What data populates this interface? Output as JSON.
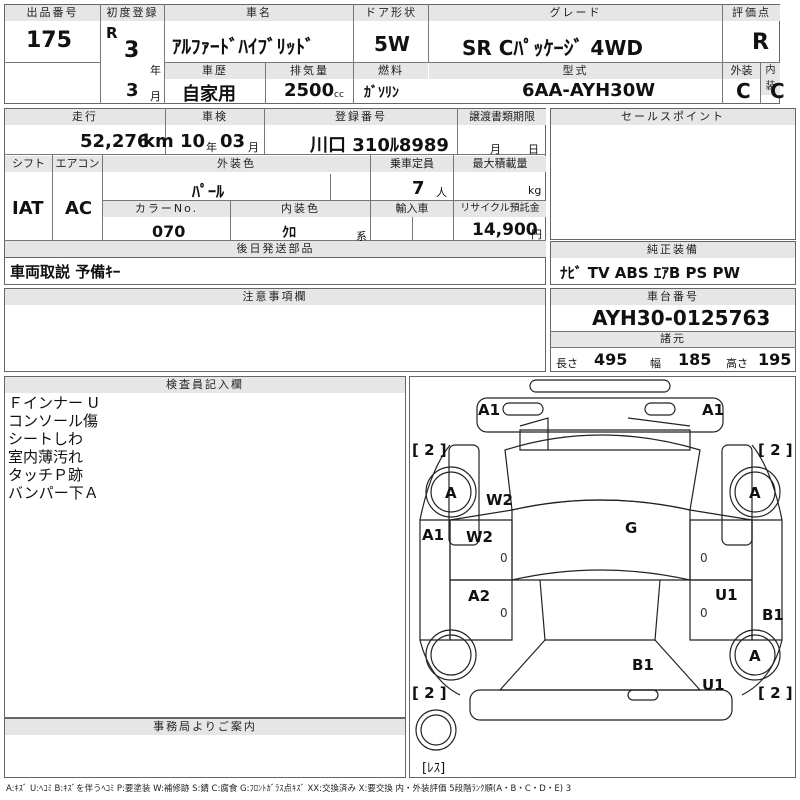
{
  "listing": {
    "lot_label": "出品番号",
    "lot_number": "175",
    "first_reg_label": "初度登録",
    "era": "R",
    "year": "3",
    "year_unit": "年",
    "month": "3",
    "month_unit": "月",
    "car_name_label": "車名",
    "car_name": "ｱﾙﾌｧｰﾄﾞﾊｲﾌﾞﾘｯﾄﾞ",
    "door_label": "ドア形状",
    "door": "5W",
    "grade_label": "グレード",
    "grade": "SR Cﾊﾟｯｹｰｼﾞ 4WD",
    "score_label": "評価点",
    "score": "R",
    "history_label": "車歴",
    "history": "自家用",
    "displacement_label": "排気量",
    "displacement": "2500",
    "displacement_unit": "cc",
    "fuel_label": "燃料",
    "fuel": "ｶﾞｿﾘﾝ",
    "model_label": "型式",
    "model": "6AA-AYH30W",
    "exterior_label": "外装",
    "exterior": "C",
    "interior_label": "内装",
    "interior": "C"
  },
  "row2": {
    "mileage_label": "走行",
    "mileage": "52,276",
    "mileage_unit": "km",
    "inspection_label": "車検",
    "insp_year": "10",
    "insp_year_unit": "年",
    "insp_month": "03",
    "insp_month_unit": "月",
    "reg_label": "登録番号",
    "reg_number": "川口 310ﾙ8989",
    "transfer_label": "譲渡書類期限",
    "transfer_month": "月",
    "transfer_day": "日",
    "shift_label": "シフト",
    "shift": "IAT",
    "ac_label": "エアコン",
    "ac": "AC",
    "ext_color_label": "外装色",
    "ext_color": "ﾊﾟｰﾙ",
    "capacity_label": "乗車定員",
    "capacity": "7",
    "capacity_unit": "人",
    "max_load_label": "最大積載量",
    "max_load_unit": "kg",
    "color_no_label": "カラーNo.",
    "color_no": "070",
    "int_color_label": "内装色",
    "int_color": "ｸﾛ",
    "int_color_unit": "系",
    "import_label": "輸入車",
    "recycle_label": "リサイクル預託金",
    "recycle": "14,900",
    "recycle_unit": "円"
  },
  "sales_point": {
    "label": "セールスポイント"
  },
  "later_parts": {
    "label": "後日発送部品",
    "value": "車両取説 予備ｷｰ"
  },
  "equipment": {
    "label": "純正装備",
    "value": "ﾅﾋﾞ TV ABS ｴｱB PS PW"
  },
  "caution": {
    "label": "注意事項欄"
  },
  "chassis": {
    "label": "車台番号",
    "value": "AYH30-0125763"
  },
  "dimensions": {
    "label": "諸元",
    "length_label": "長さ",
    "length": "495",
    "width_label": "幅",
    "width": "185",
    "height_label": "高さ",
    "height": "195"
  },
  "inspector": {
    "label": "検査員記入欄",
    "notes": [
      "Ｆインナー U",
      "コンソール傷",
      "シートしわ",
      "室内薄汚れ",
      "タッチＰ跡",
      "バンパー下Ａ"
    ]
  },
  "office": {
    "label": "事務局よりご案内"
  },
  "diagram_marks": {
    "a1_front_left": "A1",
    "a1_front_right": "A1",
    "bracket_tl": "[ 2 ]",
    "bracket_tr": "[ 2 ]",
    "bracket_bl": "[ 2 ]",
    "bracket_br": "[ 2 ]",
    "wheel_a": "A",
    "w2_upper": "W2",
    "w2_lower": "W2",
    "g": "G",
    "a1_side": "A1",
    "a2": "A2",
    "u1_right": "U1",
    "b1_right": "B1",
    "b1_rear": "B1",
    "u1_rear": "U1",
    "zero": "0",
    "spare": "[ﾚｽ]"
  },
  "legend": "A:ｷｽﾞ U:ﾍｺﾐ B:ｷｽﾞを伴うﾍｺﾐ P:要塗装 W:補修跡 S:錆 C:腐食 G:ﾌﾛﾝﾄｶﾞﾗｽ点ｷｽﾞ XX:交換済み X:要交換 内・外装評価 5段階ﾗﾝｸ順(A・B・C・D・E) 3"
}
